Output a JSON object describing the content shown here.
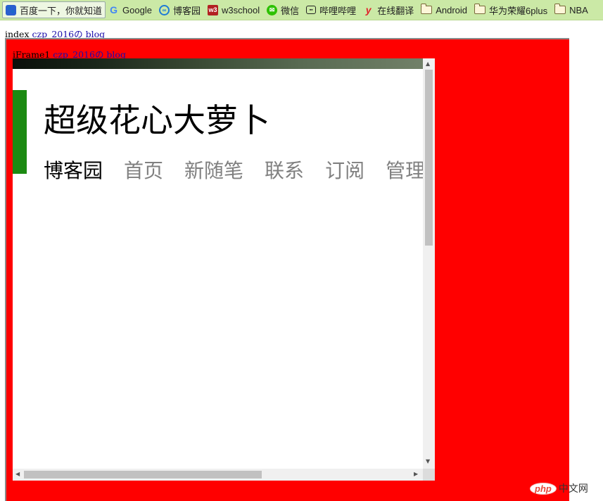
{
  "bookmarks": [
    {
      "label": "百度一下，你就知道",
      "icon": "baidu-paw-icon"
    },
    {
      "label": "Google",
      "icon": "google-icon"
    },
    {
      "label": "博客园",
      "icon": "cnblogs-icon"
    },
    {
      "label": "w3school",
      "icon": "w3school-icon"
    },
    {
      "label": "微信",
      "icon": "wechat-icon"
    },
    {
      "label": "哔哩哔哩",
      "icon": "bilibili-icon"
    },
    {
      "label": "在线翻译",
      "icon": "youdao-icon"
    },
    {
      "label": "Android",
      "icon": "folder-icon"
    },
    {
      "label": "华为荣耀6plus",
      "icon": "folder-icon"
    },
    {
      "label": "NBA",
      "icon": "folder-icon"
    }
  ],
  "icon_glyphs": {
    "baidu": "🐾",
    "google": "G",
    "cnblogs": "∞",
    "w3school": "w3",
    "wechat": "✉",
    "bilibili": "▪▪",
    "youdao": "y"
  },
  "page": {
    "prefix": "index",
    "link_text": "czp_2016の blog"
  },
  "iframe": {
    "prefix": "iFrame1",
    "link_text": "czp_2016の blog",
    "background_color": "#ff0000"
  },
  "blog": {
    "title": "超级花心大萝卜",
    "nav": [
      "博客园",
      "首页",
      "新随笔",
      "联系",
      "订阅",
      "管理"
    ],
    "accent_color": "#1c8a12"
  },
  "scroll": {
    "up": "▲",
    "down": "▼",
    "left": "◀",
    "right": "▶"
  },
  "watermark": {
    "logo": "php",
    "text": "中文网"
  }
}
